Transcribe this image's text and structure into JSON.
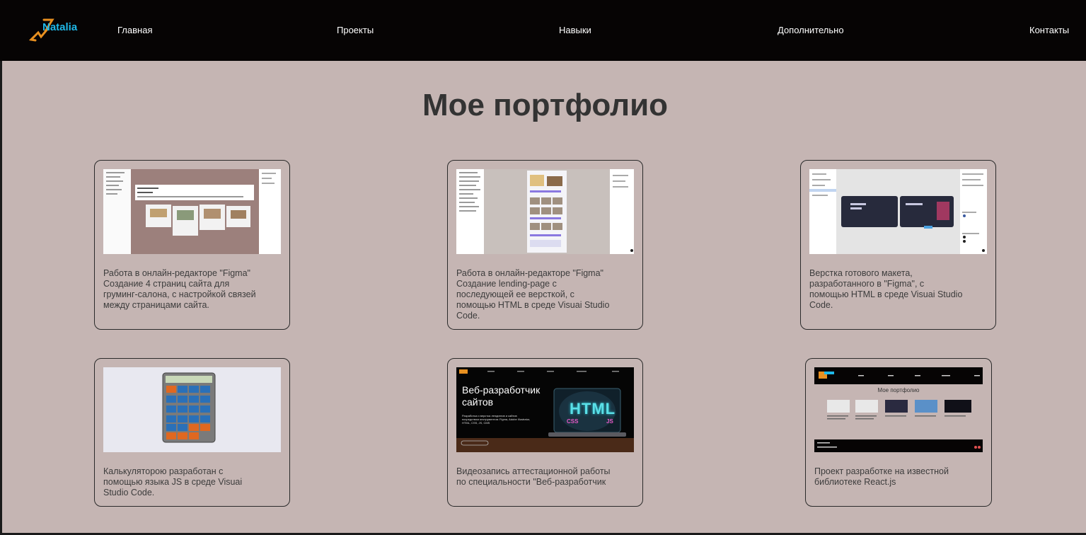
{
  "header": {
    "logo_text": "Natalia",
    "nav": [
      {
        "label": "Главная"
      },
      {
        "label": "Проекты"
      },
      {
        "label": "Навыки"
      },
      {
        "label": "Дополнительно"
      },
      {
        "label": "Контакты"
      }
    ]
  },
  "main": {
    "title": "Мое портфолио",
    "cards": [
      {
        "text": "Работа в онлайн-редакторе \"Figma\" Создание 4 страниц сайта для груминг-салона, с настройкой связей между страницами сайта."
      },
      {
        "text": "Работа в онлайн-редакторе \"Figma\" Создание lending-page с последующей ее версткой, с помощью HTML в среде Visuai Studio Code."
      },
      {
        "text": "Верстка готового макета, разработанного в \"Figma\", с помощью HTML в среде Visuai Studio Code."
      },
      {
        "text": "Калькуляторою разработан с помощью языка JS в среде Visuai Studio Code."
      },
      {
        "text": "Видеозапись аттестационной работы по специальности \"Веб-разработчик"
      },
      {
        "text": "Проект разработке на известной библиотеке React.js"
      }
    ]
  },
  "thumbs": {
    "video": {
      "headline": "Веб-разработчик сайтов",
      "sub": "Разработка и верстка лендингов и сайтов посредством инструментов: Figma, Adobe Illustrator, HTML, CSS, JS, CMS",
      "html_label": "HTML",
      "css_label": "CSS",
      "js_label": "JS"
    },
    "react": {
      "heading": "Мое портфолио"
    }
  },
  "colors": {
    "background": "#c5b5b3",
    "header": "#060404",
    "logo_accent": "#1fb8e8",
    "logo_orange": "#e89020"
  }
}
